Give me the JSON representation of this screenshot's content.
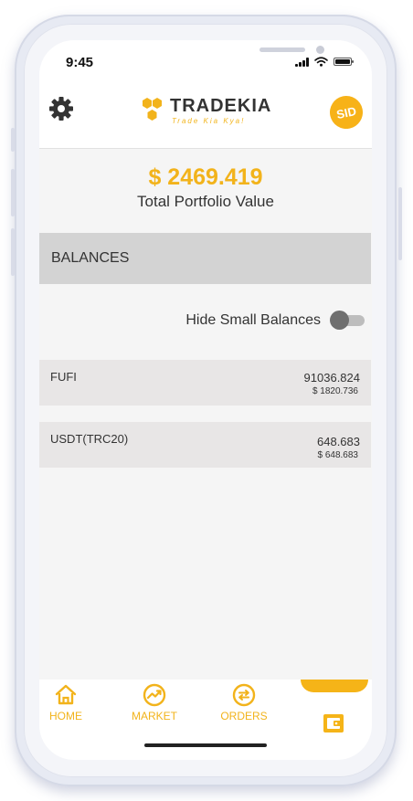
{
  "status_bar": {
    "time": "9:45"
  },
  "header": {
    "brand_name": "TRADEKIA",
    "brand_tagline": "Trade Kia Kya!",
    "avatar_initials": "SID",
    "settings_icon": "gear-icon",
    "accent_color": "#f2b31b"
  },
  "portfolio": {
    "value": "$ 2469.419",
    "label": "Total Portfolio Value"
  },
  "balances": {
    "title": "BALANCES",
    "hide_small_label": "Hide Small Balances",
    "hide_small_enabled": false,
    "items": [
      {
        "name": "FUFI",
        "amount": "91036.824",
        "usd_value": "$ 1820.736"
      },
      {
        "name": "USDT(TRC20)",
        "amount": "648.683",
        "usd_value": "$ 648.683"
      }
    ]
  },
  "bottom_nav": {
    "items": [
      {
        "label": "HOME",
        "icon": "home-icon"
      },
      {
        "label": "MARKET",
        "icon": "market-icon"
      },
      {
        "label": "ORDERS",
        "icon": "orders-icon"
      }
    ],
    "active_icon": "wallet-icon"
  }
}
